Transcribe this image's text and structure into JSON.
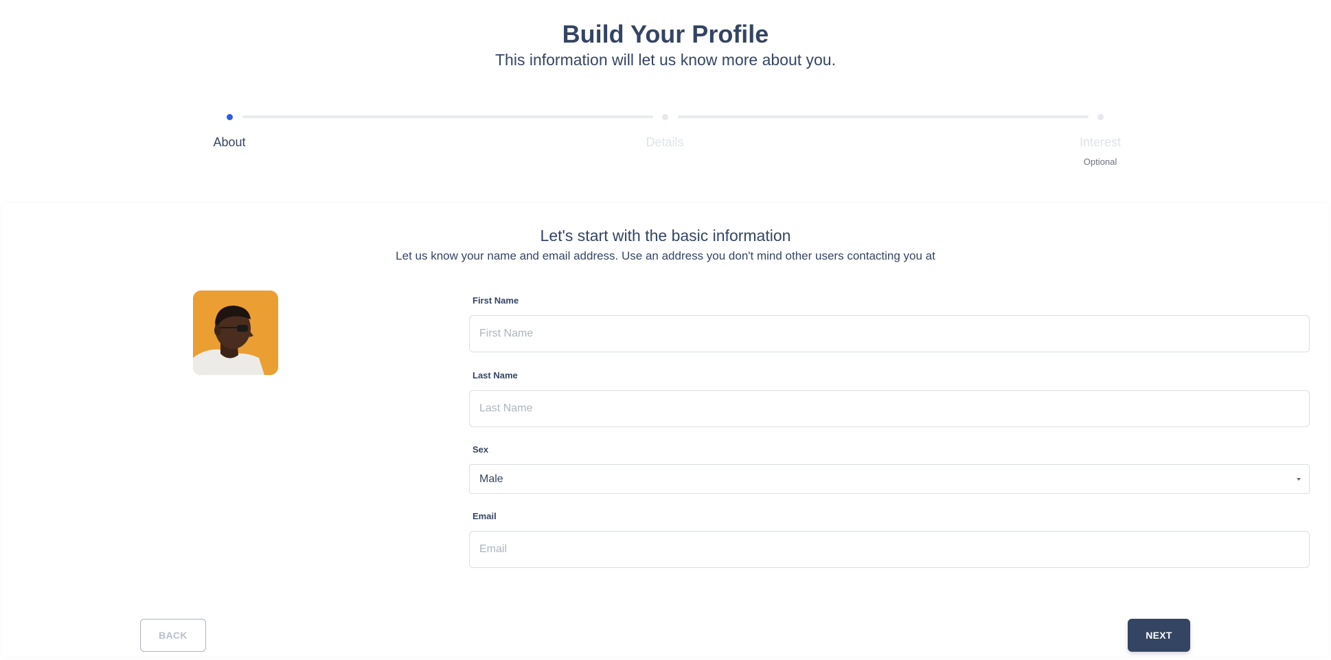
{
  "header": {
    "title": "Build Your Profile",
    "subtitle": "This information will let us know more about you."
  },
  "stepper": {
    "steps": [
      {
        "label": "About",
        "active": true
      },
      {
        "label": "Details",
        "active": false
      },
      {
        "label": "Interest",
        "active": false,
        "note": "Optional"
      }
    ]
  },
  "card": {
    "title": "Let's start with the basic information",
    "description": "Let us know your name and email address. Use an address you don't mind other users contacting you at"
  },
  "form": {
    "first_name": {
      "label": "First Name",
      "placeholder": "First Name",
      "value": ""
    },
    "last_name": {
      "label": "Last Name",
      "placeholder": "Last Name",
      "value": ""
    },
    "sex": {
      "label": "Sex",
      "selected": "Male"
    },
    "email": {
      "label": "Email",
      "placeholder": "Email",
      "value": ""
    }
  },
  "actions": {
    "back_label": "Back",
    "next_label": "Next"
  },
  "colors": {
    "accent": "#2d5be3",
    "primary": "#344563",
    "avatar_bg": "#e99a2f"
  },
  "icons": {
    "avatar": "user-photo",
    "select_caret": "chevron-down-icon"
  }
}
